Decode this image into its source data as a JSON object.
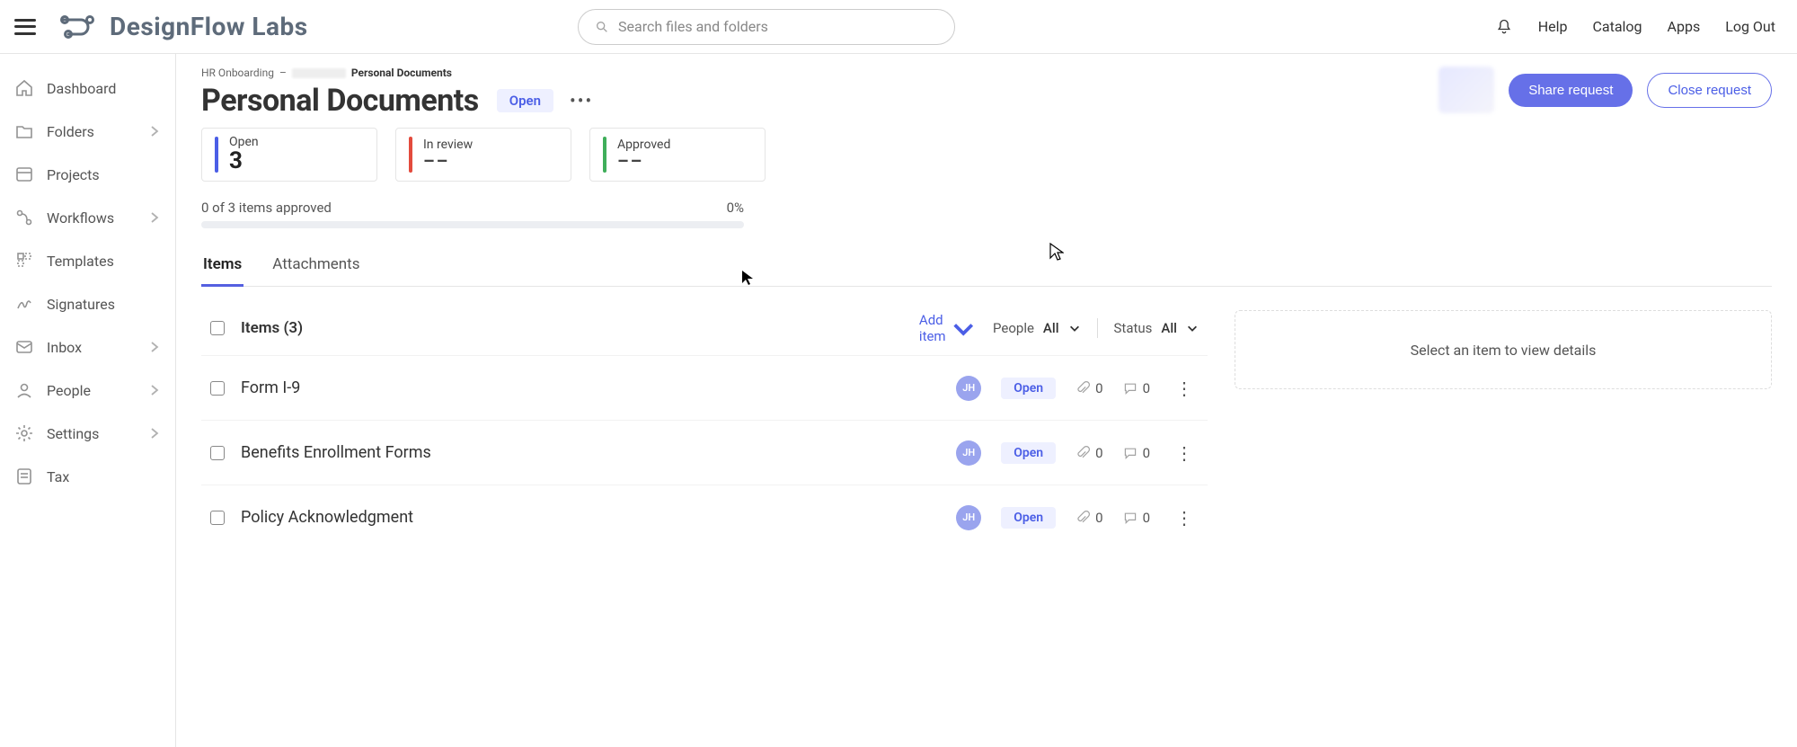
{
  "header": {
    "brand": "DesignFlow Labs",
    "search_placeholder": "Search files and folders",
    "links": {
      "help": "Help",
      "catalog": "Catalog",
      "apps": "Apps",
      "logout": "Log Out"
    }
  },
  "sidebar": {
    "items": [
      {
        "label": "Dashboard",
        "chevron": false
      },
      {
        "label": "Folders",
        "chevron": true
      },
      {
        "label": "Projects",
        "chevron": false
      },
      {
        "label": "Workflows",
        "chevron": true
      },
      {
        "label": "Templates",
        "chevron": false
      },
      {
        "label": "Signatures",
        "chevron": false
      },
      {
        "label": "Inbox",
        "chevron": true
      },
      {
        "label": "People",
        "chevron": true
      },
      {
        "label": "Settings",
        "chevron": true
      },
      {
        "label": "Tax",
        "chevron": false
      }
    ]
  },
  "breadcrumb": {
    "root": "HR Onboarding",
    "sep": "–",
    "current": "Personal Documents"
  },
  "page": {
    "title": "Personal Documents",
    "status": "Open",
    "share_btn": "Share request",
    "close_btn": "Close request"
  },
  "status_cards": [
    {
      "label": "Open",
      "value": "3",
      "color": "#4b5ee6"
    },
    {
      "label": "In review",
      "value": "––",
      "color": "#e34b3d"
    },
    {
      "label": "Approved",
      "value": "––",
      "color": "#3fae5a"
    }
  ],
  "progress": {
    "text": "0 of 3 items approved",
    "pct": "0%"
  },
  "tabs": [
    {
      "label": "Items",
      "active": true
    },
    {
      "label": "Attachments",
      "active": false
    }
  ],
  "items": {
    "header": "Items (3)",
    "add_label": "Add item",
    "filter_people_label": "People",
    "filter_people_value": "All",
    "filter_status_label": "Status",
    "filter_status_value": "All",
    "rows": [
      {
        "name": "Form I-9",
        "assignee": "JH",
        "status": "Open",
        "attachments": "0",
        "comments": "0"
      },
      {
        "name": "Benefits Enrollment Forms",
        "assignee": "JH",
        "status": "Open",
        "attachments": "0",
        "comments": "0"
      },
      {
        "name": "Policy Acknowledgment",
        "assignee": "JH",
        "status": "Open",
        "attachments": "0",
        "comments": "0"
      }
    ]
  },
  "detail_panel": {
    "empty": "Select an item to view details"
  }
}
